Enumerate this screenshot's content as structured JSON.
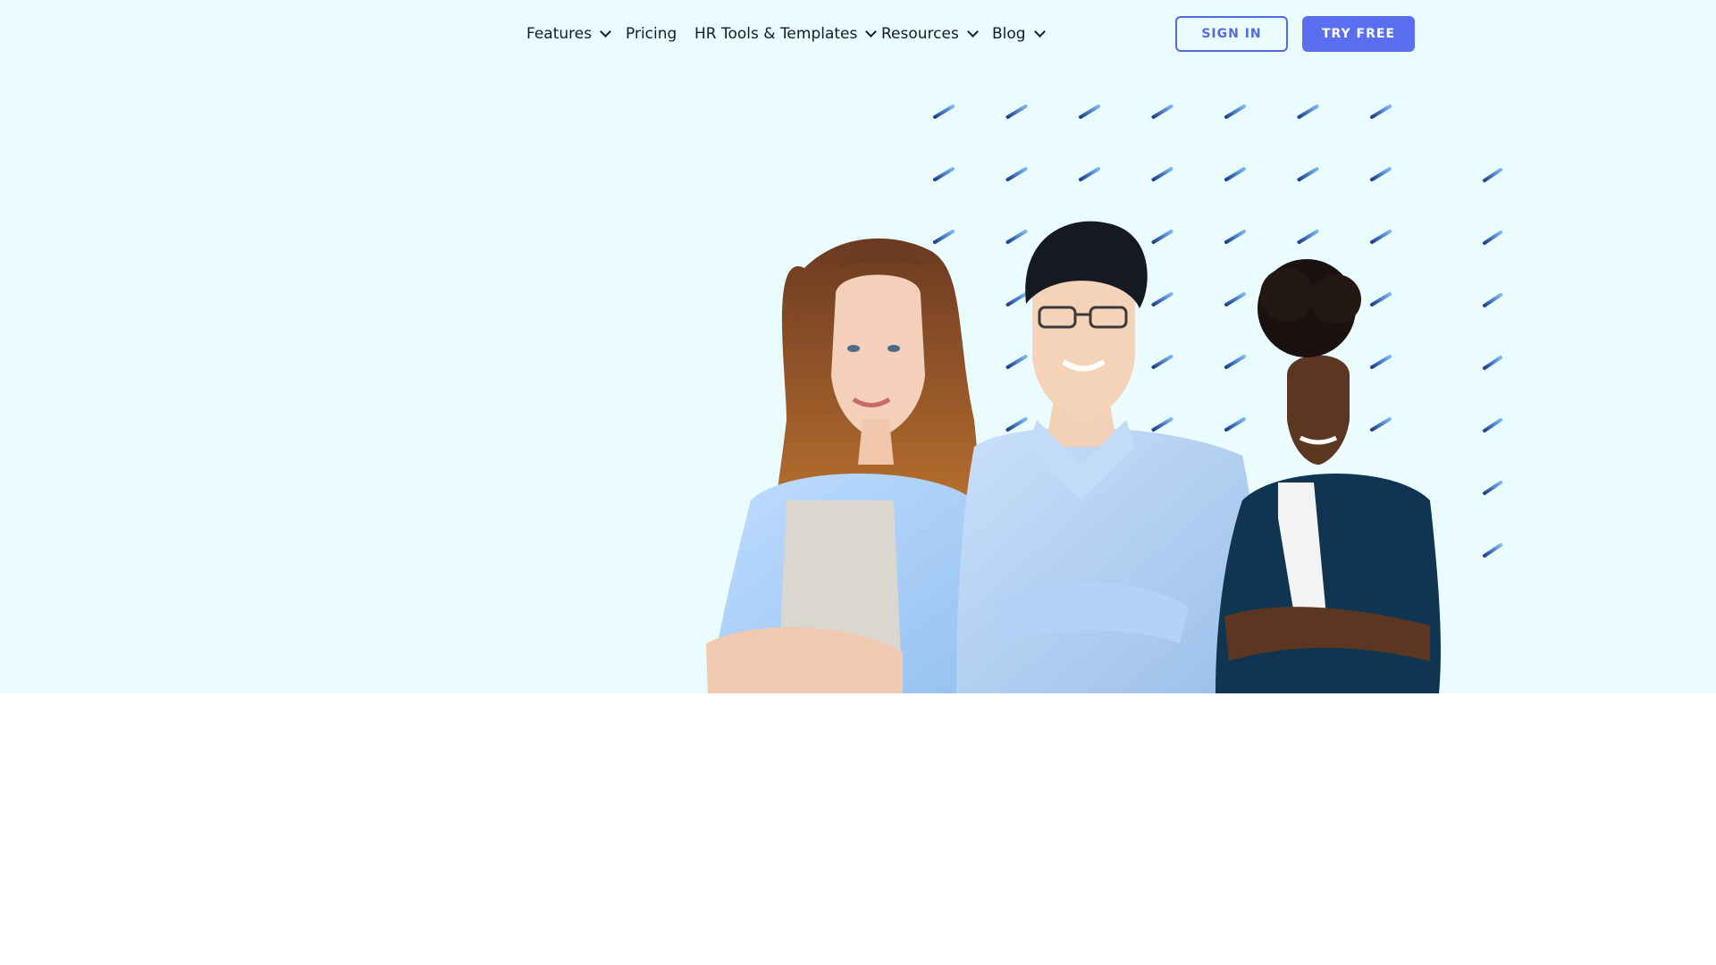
{
  "nav": {
    "items": [
      {
        "label": "Features",
        "has_dropdown": true
      },
      {
        "label": "Pricing",
        "has_dropdown": false
      },
      {
        "label": "HR Tools & Templates",
        "has_dropdown": true
      },
      {
        "label": "Resources",
        "has_dropdown": true
      },
      {
        "label": "Blog",
        "has_dropdown": true
      }
    ],
    "dropdown_icon": "chevron-down-icon"
  },
  "actions": {
    "sign_in_label": "SIGN IN",
    "try_free_label": "TRY FREE"
  },
  "hero": {
    "image": "three smiling professionals with arms crossed",
    "pattern": "blue dash pattern"
  },
  "colors": {
    "hero_background": "#eafcfd",
    "page_background": "#ffffff",
    "accent": "#5a6ff0",
    "text": "#141a2b",
    "dash_dark": "#1d3f8f",
    "dash_light": "#79b6f7"
  }
}
